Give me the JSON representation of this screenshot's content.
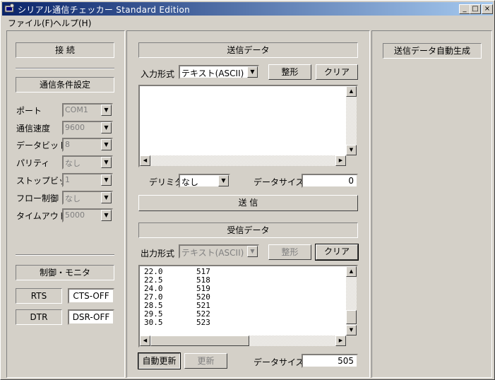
{
  "window": {
    "title": "シリアル通信チェッカー  Standard Edition",
    "min": "_",
    "max": "□",
    "close": "×"
  },
  "menu": [
    "ファイル(F)",
    "ヘルプ(H)"
  ],
  "left": {
    "connect": "接 続",
    "settings_header": "通信条件設定",
    "settings": [
      {
        "label": "ポート",
        "value": "COM1"
      },
      {
        "label": "通信速度",
        "value": "9600"
      },
      {
        "label": "データビット",
        "value": "8"
      },
      {
        "label": "パリティ",
        "value": "なし"
      },
      {
        "label": "ストップビット",
        "value": "1"
      },
      {
        "label": "フロー制御",
        "value": "なし"
      },
      {
        "label": "タイムアウト",
        "value": "5000"
      }
    ],
    "control_header": "制御・モニタ",
    "rts": "RTS",
    "cts": "CTS-OFF",
    "dtr": "DTR",
    "dsr": "DSR-OFF"
  },
  "send": {
    "header": "送信データ",
    "format_label": "入力形式",
    "format_value": "テキスト(ASCII)",
    "shape_btn": "整形",
    "clear_btn": "クリア",
    "delimiter_label": "デリミタ",
    "delimiter_value": "なし",
    "size_label": "データサイズ",
    "size_value": "0",
    "send_btn": "送 信"
  },
  "recv": {
    "header": "受信データ",
    "format_label": "出力形式",
    "format_value": "テキスト(ASCII)",
    "shape_btn": "整形",
    "clear_btn": "クリア",
    "lines": [
      [
        "22.0",
        "517"
      ],
      [
        "22.5",
        "518"
      ],
      [
        "24.0",
        "519"
      ],
      [
        "27.0",
        "520"
      ],
      [
        "28.5",
        "521"
      ],
      [
        "29.5",
        "522"
      ],
      [
        "30.5",
        "523"
      ]
    ],
    "auto_btn": "自動更新",
    "update_btn": "更新",
    "size_label": "データサイズ",
    "size_value": "505"
  },
  "right": {
    "autogen": "送信データ自動生成"
  }
}
